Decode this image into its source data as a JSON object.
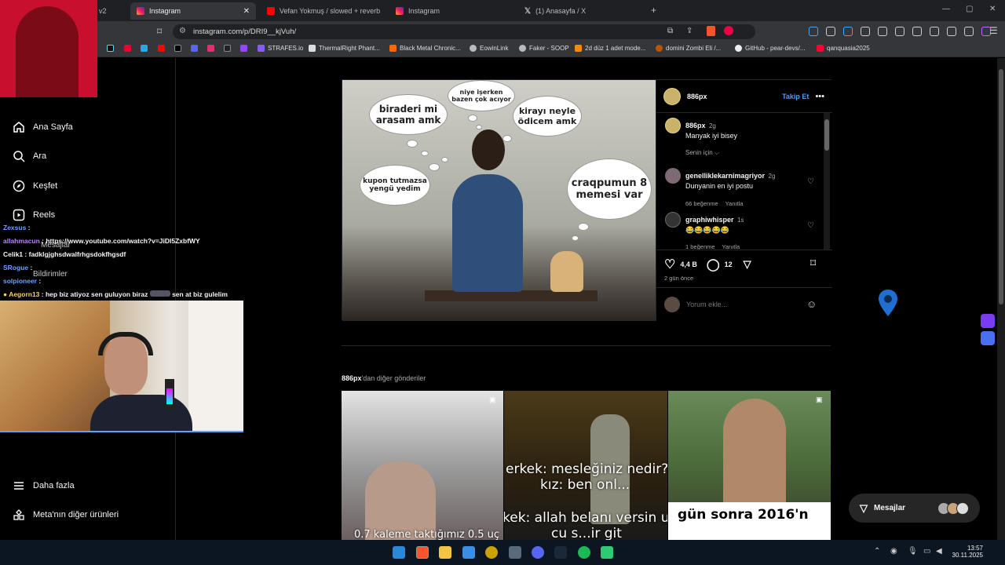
{
  "browser": {
    "tabs": [
      {
        "label": "v2",
        "active": false
      },
      {
        "label": "Instagram",
        "active": true
      },
      {
        "label": "Vefan Yokmuş / slowed + reverb (Mo",
        "active": false
      },
      {
        "label": "Instagram",
        "active": false
      },
      {
        "label": "(1) Anasayfa / X",
        "active": false
      }
    ],
    "url": "instagram.com/p/DRI9__kjVuh/",
    "bookmarks": [
      "STRAFES.io",
      "ThermalRight Phant...",
      "Black Metal Chronic...",
      "EowinLink",
      "Faker - SOOP",
      "2d düz 1 adet mode...",
      "domini Zombi Eli /...",
      "GitHub - pear-devs/...",
      "qanquasia2025"
    ]
  },
  "sidebar": {
    "items": [
      "Ana Sayfa",
      "Ara",
      "Keşfet",
      "Reels",
      "Mesajlar",
      "Bildirimler"
    ],
    "bottom": [
      "Daha fazla",
      "Meta'nın diğer ürünleri"
    ]
  },
  "post": {
    "author": "886px",
    "follow": "Takip Et",
    "caption_time": "2g",
    "caption": "Manyak iyi bisey",
    "translate": "Senin için",
    "comments": [
      {
        "user": "genelliklekarnimagriyor",
        "time": "2g",
        "text": "Dunyanin en iyi postu",
        "likes": "66 beğenme",
        "reply": "Yanıtla"
      },
      {
        "user": "graphiwhisper",
        "time": "1s",
        "text": "😂😂😂😂😂",
        "likes": "1 beğenme",
        "reply": "Yanıtla"
      }
    ],
    "likes": "4,4 B",
    "comment_count": "12",
    "posted": "2 gün önce",
    "comment_placeholder": "Yorum ekle...",
    "meme_bubbles": [
      "biraderi mi arasam amk",
      "niye işerken bazen çok acıyor",
      "kirayı neyle ödicem amk",
      "kupon tutmazsa yengü yedim",
      "craqpumun 8 memesi var"
    ]
  },
  "more_posts": {
    "title_user": "886px",
    "title_suffix": "'dan diğer gönderiler",
    "captions": [
      {
        "lines": [
          "0.7 kaleme taktığımız 0.5 uç"
        ]
      },
      {
        "lines": [
          "erkek: mesleğiniz nedir?",
          "kız: ben onl...",
          "kek: allah belanı versin uc",
          "cu s...ir git"
        ]
      },
      {
        "lines": [
          "gün sonra 2016'n"
        ]
      }
    ]
  },
  "messages_button": "Mesajlar",
  "chat": [
    {
      "user": "Zexsus",
      "color": "#6fa0ff",
      "text": ""
    },
    {
      "user": "allahmacun",
      "color": "#c080ff",
      "text": "https://www.youtube.com/watch?v=JiDI5ZxbfWY"
    },
    {
      "user": "Celik1",
      "color": "#ffffff",
      "text": "fadklgjghsdwalfrhgsdokfhgsdf"
    },
    {
      "user": "SRogue",
      "color": "#6fa0ff",
      "text": ""
    },
    {
      "user": "solpioneer",
      "color": "#6fa0ff",
      "text": ""
    },
    {
      "user": "Aegorn13",
      "color": "#ffd24a",
      "text": "hep biz atiyoz sen guluyon biraz",
      "tail": "sen at biz gulelim"
    }
  ],
  "clock": {
    "time": "13:57",
    "date": "30.11.2025"
  }
}
